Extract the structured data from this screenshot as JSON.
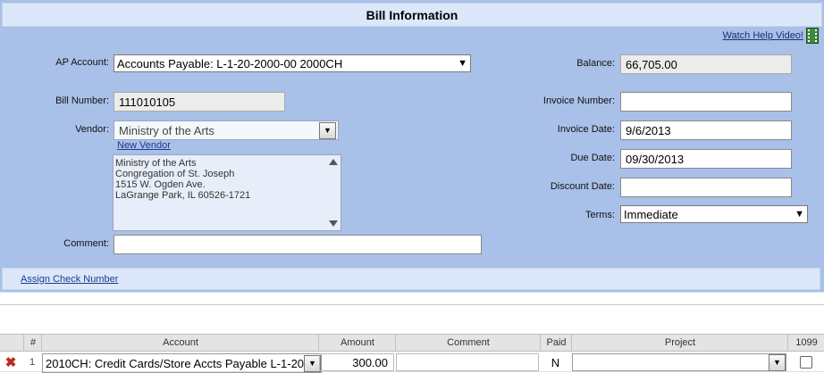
{
  "title": "Bill Information",
  "help_link": "Watch Help Video!",
  "form": {
    "ap_account": {
      "label": "AP Account:",
      "value": "Accounts Payable: L-1-20-2000-00 2000CH"
    },
    "bill_number": {
      "label": "Bill Number:",
      "value": "111010105"
    },
    "vendor": {
      "label": "Vendor:",
      "value": "Ministry of the Arts",
      "new_vendor_link": "New Vendor"
    },
    "vendor_address": [
      "Ministry of the Arts",
      "Congregation of St. Joseph",
      "1515 W. Ogden Ave.",
      "LaGrange Park, IL 60526-1721"
    ],
    "comment": {
      "label": "Comment:",
      "value": ""
    },
    "balance": {
      "label": "Balance:",
      "value": "66,705.00"
    },
    "invoice_number": {
      "label": "Invoice Number:",
      "value": ""
    },
    "invoice_date": {
      "label": "Invoice Date:",
      "value": "9/6/2013"
    },
    "due_date": {
      "label": "Due Date:",
      "value": "09/30/2013"
    },
    "discount_date": {
      "label": "Discount Date:",
      "value": ""
    },
    "terms": {
      "label": "Terms:",
      "value": "Immediate"
    }
  },
  "assign_check_link": "Assign Check Number",
  "grid": {
    "columns": [
      "#",
      "Account",
      "Amount",
      "Comment",
      "Paid",
      "Project",
      "1099"
    ],
    "rows": [
      {
        "num": "1",
        "account": "2010CH: Credit Cards/Store Accts Payable L-1-20",
        "amount": "300.00",
        "comment": "",
        "paid": "N",
        "project": ""
      }
    ]
  }
}
